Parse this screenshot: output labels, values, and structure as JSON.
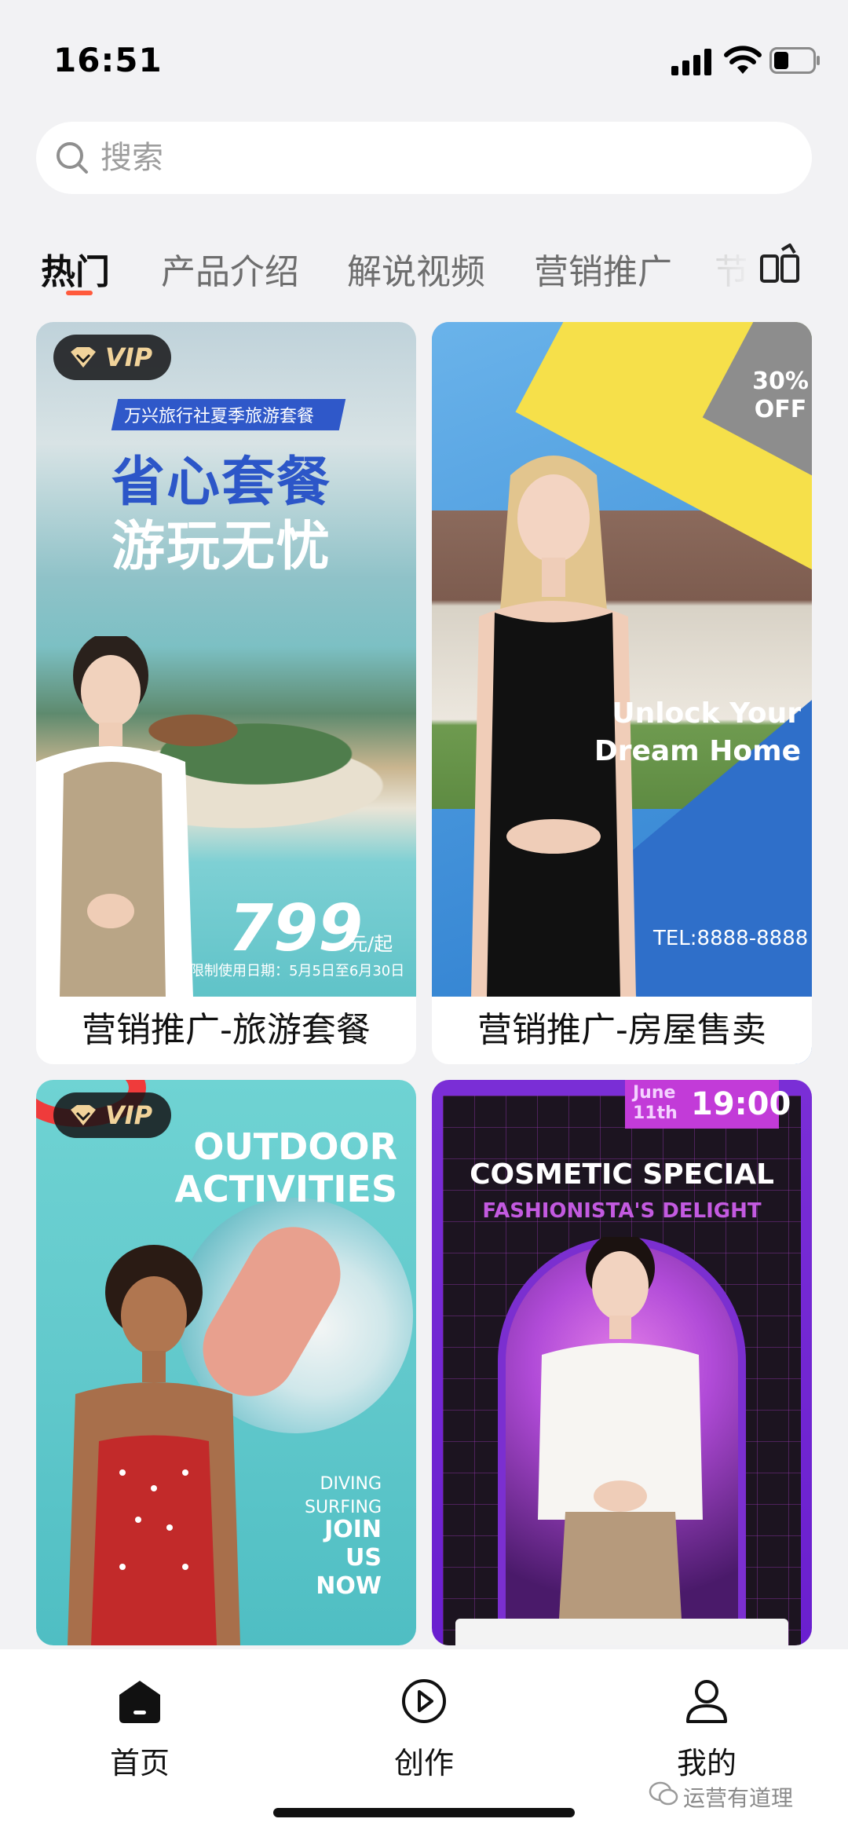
{
  "status_bar": {
    "time": "16:51"
  },
  "search": {
    "placeholder": "搜索"
  },
  "tabs": [
    {
      "label": "热门",
      "active": true
    },
    {
      "label": "产品介绍",
      "active": false
    },
    {
      "label": "解说视频",
      "active": false
    },
    {
      "label": "营销推广",
      "active": false
    },
    {
      "label": "节",
      "active": false
    }
  ],
  "accent_color": "#ff5a3c",
  "cards": [
    {
      "vip": "VIP",
      "caption": "营销推广-旅游套餐",
      "ribbon": "万兴旅行社夏季旅游套餐",
      "headline1": "省心套餐",
      "headline2": "游玩无忧",
      "price": "799",
      "price_unit": "元/起",
      "dates": "限制使用日期：5月5日至6月30日"
    },
    {
      "caption": "营销推广-房屋售卖",
      "sale": "30% OFF",
      "tagline": "Unlock Your Dream Home",
      "tel": "TEL:8888-8888"
    },
    {
      "vip": "VIP",
      "title": "OUTDOOR ACTIVITIES",
      "side": "DIVING SURFING",
      "join": "JOIN US NOW"
    },
    {
      "date_small": "June 11th",
      "date_time": "19:00",
      "title": "COSMETIC SPECIAL",
      "subtitle": "FASHIONISTA'S DELIGHT"
    }
  ],
  "bottom_nav": [
    {
      "label": "首页",
      "icon": "home-icon"
    },
    {
      "label": "创作",
      "icon": "play-circle-icon"
    },
    {
      "label": "我的",
      "icon": "user-icon"
    }
  ],
  "watermark": "运营有道理"
}
